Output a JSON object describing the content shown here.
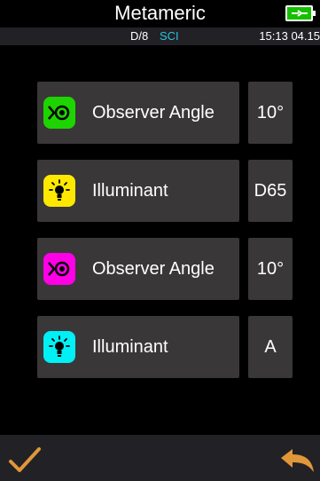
{
  "header": {
    "title": "Metameric",
    "battery_icon": "battery-charging-icon"
  },
  "status": {
    "geometry": "D/8",
    "mode": "SCI",
    "time": "15:13 04.15"
  },
  "rows": [
    {
      "label": "Observer Angle",
      "value": "10°",
      "icon": "eye-icon",
      "icon_color": "#1ed400"
    },
    {
      "label": "Illuminant",
      "value": "D65",
      "icon": "bulb-icon",
      "icon_color": "#ffe800"
    },
    {
      "label": "Observer Angle",
      "value": "10°",
      "icon": "eye-icon",
      "icon_color": "#ff00e6"
    },
    {
      "label": "Illuminant",
      "value": "A",
      "icon": "bulb-icon",
      "icon_color": "#00f0f5"
    }
  ],
  "footer": {
    "confirm_icon": "checkmark-icon",
    "back_icon": "back-arrow-icon",
    "accent_color": "#e0973a"
  }
}
